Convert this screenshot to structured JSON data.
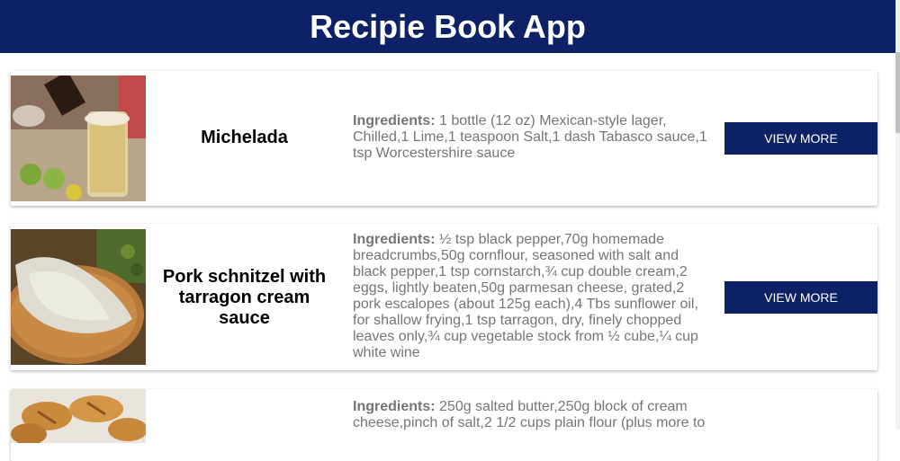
{
  "header": {
    "title": "Recipie Book App"
  },
  "recipes": [
    {
      "name": "Michelada",
      "ingredients_label": "Ingredients:",
      "ingredients": "1 bottle (12 oz) Mexican-style lager, Chilled,1 Lime,1 teaspoon Salt,1 dash Tabasco sauce,1 tsp Worcestershire sauce",
      "button_label": "VIEW MORE",
      "image_alt": "michelada-photo"
    },
    {
      "name": "Pork schnitzel with tarragon cream sauce",
      "ingredients_label": "Ingredients:",
      "ingredients": "½ tsp black pepper,70g homemade breadcrumbs,50g cornflour, seasoned with salt and black pepper,1 tsp cornstarch,¾ cup double cream,2 eggs, lightly beaten,50g parmesan cheese, grated,2 pork escalopes (about 125g each),4 Tbs sunflower oil, for shallow frying,1 tsp tarragon, dry, finely chopped leaves only,¾ cup vegetable stock from ½ cube,¼ cup white wine",
      "button_label": "VIEW MORE",
      "image_alt": "pork-schnitzel-photo"
    },
    {
      "name": "",
      "ingredients_label": "Ingredients:",
      "ingredients": "250g salted butter,250g block of cream cheese,pinch of salt,2 1/2 cups plain flour (plus more to",
      "image_alt": "croissant-photo"
    }
  ],
  "colors": {
    "brand": "#0d2266",
    "text_muted": "#757575"
  }
}
